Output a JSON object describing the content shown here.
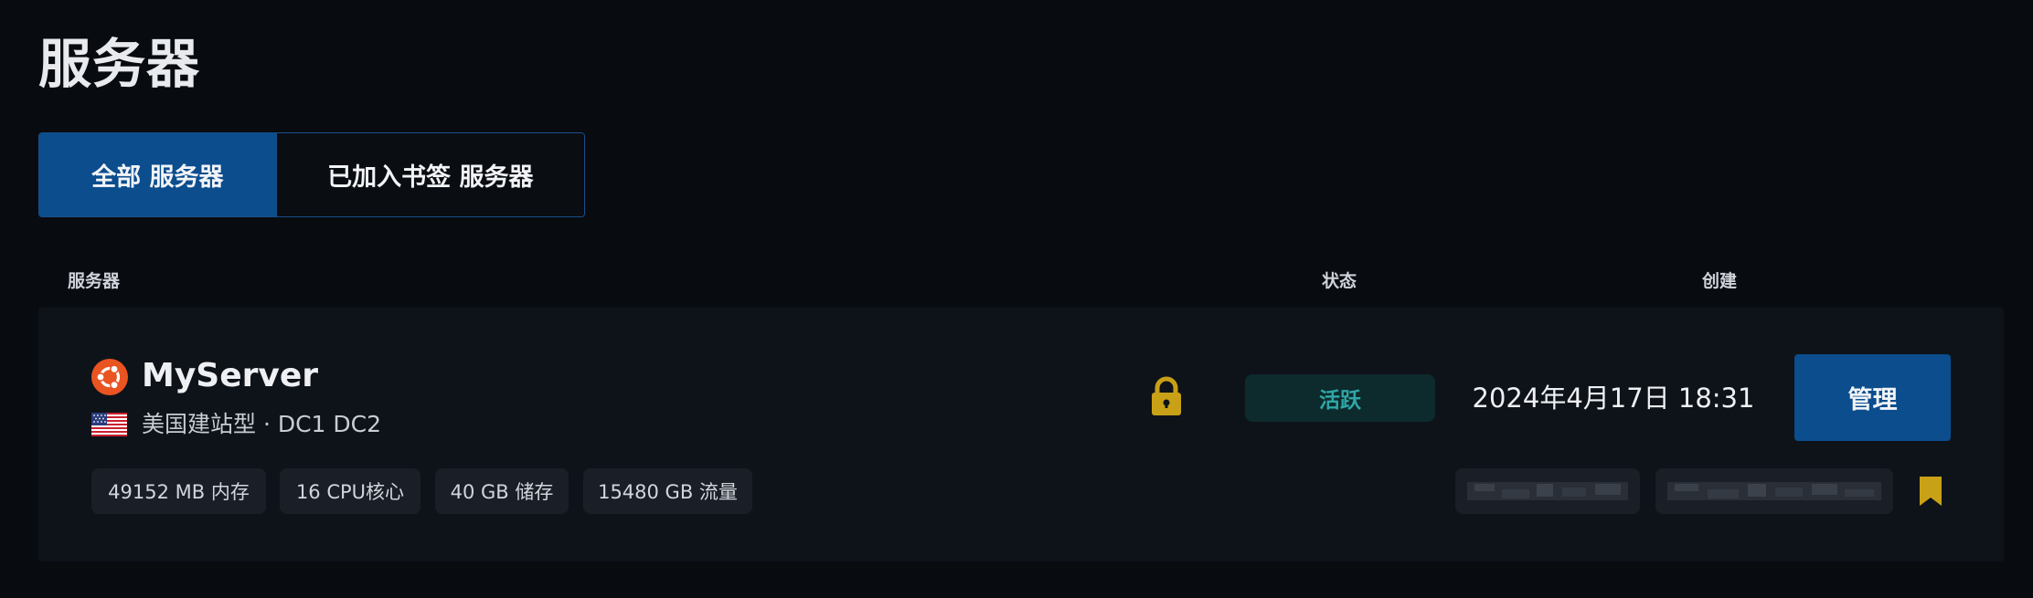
{
  "page": {
    "title": "服务器"
  },
  "tabs": [
    {
      "label": "全部 服务器",
      "active": true
    },
    {
      "label": "已加入书签 服务器",
      "active": false
    }
  ],
  "table": {
    "columns": {
      "server": "服务器",
      "status": "状态",
      "created": "创建"
    }
  },
  "server": {
    "os_icon": "ubuntu-icon",
    "name": "MyServer",
    "flag_icon": "us-flag-icon",
    "location": "美国建站型 · DC1 DC2",
    "specs": [
      "49152 MB 内存",
      "16 CPU核心",
      "40 GB 储存",
      "15480 GB 流量"
    ],
    "lock_icon": "lock-icon",
    "status": "活跃",
    "created": "2024年4月17日 18:31",
    "manage_label": "管理",
    "bookmark_icon": "bookmark-icon"
  },
  "colors": {
    "background": "#080b10",
    "card": "#0e131a",
    "accent_blue": "#0b4d8d",
    "status_text": "#2fa6a6",
    "status_bg": "#0d2a2d",
    "gold": "#c9a116",
    "ubuntu_orange": "#e95420"
  }
}
